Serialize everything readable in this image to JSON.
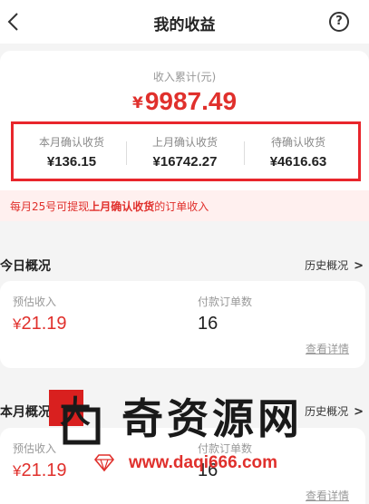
{
  "nav": {
    "title": "我的收益",
    "help": "?"
  },
  "summary": {
    "cumulative_label": "收入累计(元)",
    "currency": "¥",
    "cumulative_value": "9987.49",
    "stats": [
      {
        "label": "本月确认收货",
        "value": "¥136.15"
      },
      {
        "label": "上月确认收货",
        "value": "¥16742.27"
      },
      {
        "label": "待确认收货",
        "value": "¥4616.63"
      }
    ]
  },
  "notice": {
    "prefix": "每月25号可提现",
    "highlight": "上月确认收货",
    "suffix": "的订单收入"
  },
  "today": {
    "title": "今日概况",
    "history_link": "历史概况",
    "est_label": "预估收入",
    "est_value": "21.19",
    "orders_label": "付款订单数",
    "orders_value": "16",
    "detail_link": "查看详情"
  },
  "month": {
    "title": "本月概况",
    "history_link": "历史概况",
    "est_label": "预估收入",
    "est_value": "21.19",
    "orders_label": "付款订单数",
    "orders_value": "16",
    "detail_link": "查看详情"
  },
  "watermark": {
    "brand": "奇资源网",
    "url": "www.daqi666.com",
    "logo_char": "大"
  },
  "colors": {
    "accent": "#e0302c",
    "box_border": "#e8262c"
  }
}
